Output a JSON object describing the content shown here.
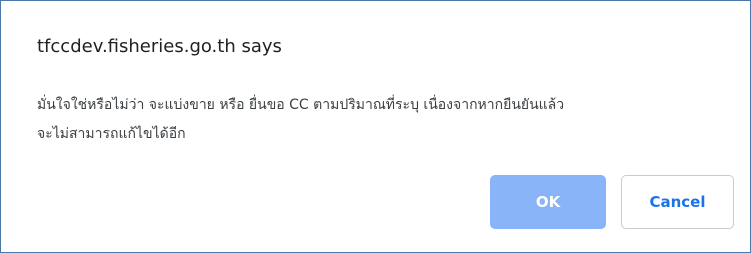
{
  "dialog": {
    "title": "tfccdev.fisheries.go.th says",
    "message_line1": "มั่นใจใช่หรือไม่ว่า จะแบ่งขาย หรือ ยื่นขอ CC ตามปริมาณที่ระบุ เนื่องจากหากยืนยันแล้ว",
    "message_line2": "จะไม่สามารถแก้ไขได้อีก",
    "ok_label": "OK",
    "cancel_label": "Cancel"
  },
  "colors": {
    "border": "#4a78a8",
    "ok_background": "#8ab4f8",
    "cancel_text": "#1a73e8"
  }
}
